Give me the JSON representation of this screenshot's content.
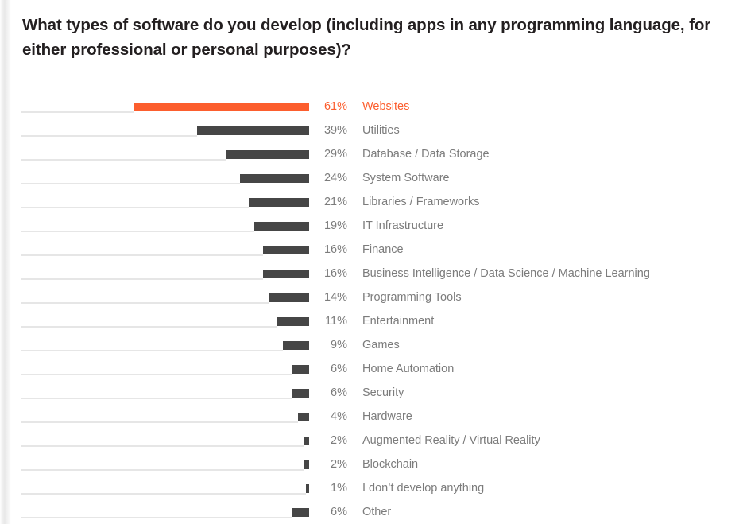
{
  "chart_title": "What types of software do you develop (including apps in any programming language, for either professional or personal purposes)?",
  "colors": {
    "highlight": "#fc5e2e",
    "bar": "#464646",
    "track": "#e6e6e6",
    "text": "#7c7c7c",
    "title": "#231f20"
  },
  "chart_data": {
    "type": "bar",
    "orientation": "horizontal",
    "title": "What types of software do you develop (including apps in any programming language, for either professional or personal purposes)?",
    "xlabel": "",
    "ylabel": "",
    "xlim": [
      0,
      61
    ],
    "grid": false,
    "legend": false,
    "value_suffix": "%",
    "highlight_index": 0,
    "categories": [
      "Websites",
      "Utilities",
      "Database / Data Storage",
      "System Software",
      "Libraries / Frameworks",
      "IT Infrastructure",
      "Finance",
      "Business Intelligence / Data Science / Machine Learning",
      "Programming Tools",
      "Entertainment",
      "Games",
      "Home Automation",
      "Security",
      "Hardware",
      "Augmented Reality / Virtual Reality",
      "Blockchain",
      "I don’t develop anything",
      "Other"
    ],
    "values": [
      61,
      39,
      29,
      24,
      21,
      19,
      16,
      16,
      14,
      11,
      9,
      6,
      6,
      4,
      2,
      2,
      1,
      6
    ],
    "value_labels": [
      "61%",
      "39%",
      "29%",
      "24%",
      "21%",
      "19%",
      "16%",
      "16%",
      "14%",
      "11%",
      "9%",
      "6%",
      "6%",
      "4%",
      "2%",
      "2%",
      "1%",
      "6%"
    ],
    "rows": [
      {
        "label": "Websites",
        "value": 61,
        "value_label": "61%",
        "highlight": true
      },
      {
        "label": "Utilities",
        "value": 39,
        "value_label": "39%",
        "highlight": false
      },
      {
        "label": "Database / Data Storage",
        "value": 29,
        "value_label": "29%",
        "highlight": false
      },
      {
        "label": "System Software",
        "value": 24,
        "value_label": "24%",
        "highlight": false
      },
      {
        "label": "Libraries / Frameworks",
        "value": 21,
        "value_label": "21%",
        "highlight": false
      },
      {
        "label": "IT Infrastructure",
        "value": 19,
        "value_label": "19%",
        "highlight": false
      },
      {
        "label": "Finance",
        "value": 16,
        "value_label": "16%",
        "highlight": false
      },
      {
        "label": "Business Intelligence / Data Science / Machine Learning",
        "value": 16,
        "value_label": "16%",
        "highlight": false
      },
      {
        "label": "Programming Tools",
        "value": 14,
        "value_label": "14%",
        "highlight": false
      },
      {
        "label": "Entertainment",
        "value": 11,
        "value_label": "11%",
        "highlight": false
      },
      {
        "label": "Games",
        "value": 9,
        "value_label": "9%",
        "highlight": false
      },
      {
        "label": "Home Automation",
        "value": 6,
        "value_label": "6%",
        "highlight": false
      },
      {
        "label": "Security",
        "value": 6,
        "value_label": "6%",
        "highlight": false
      },
      {
        "label": "Hardware",
        "value": 4,
        "value_label": "4%",
        "highlight": false
      },
      {
        "label": "Augmented Reality / Virtual Reality",
        "value": 2,
        "value_label": "2%",
        "highlight": false
      },
      {
        "label": "Blockchain",
        "value": 2,
        "value_label": "2%",
        "highlight": false
      },
      {
        "label": "I don’t develop anything",
        "value": 1,
        "value_label": "1%",
        "highlight": false
      },
      {
        "label": "Other",
        "value": 6,
        "value_label": "6%",
        "highlight": false
      }
    ]
  }
}
